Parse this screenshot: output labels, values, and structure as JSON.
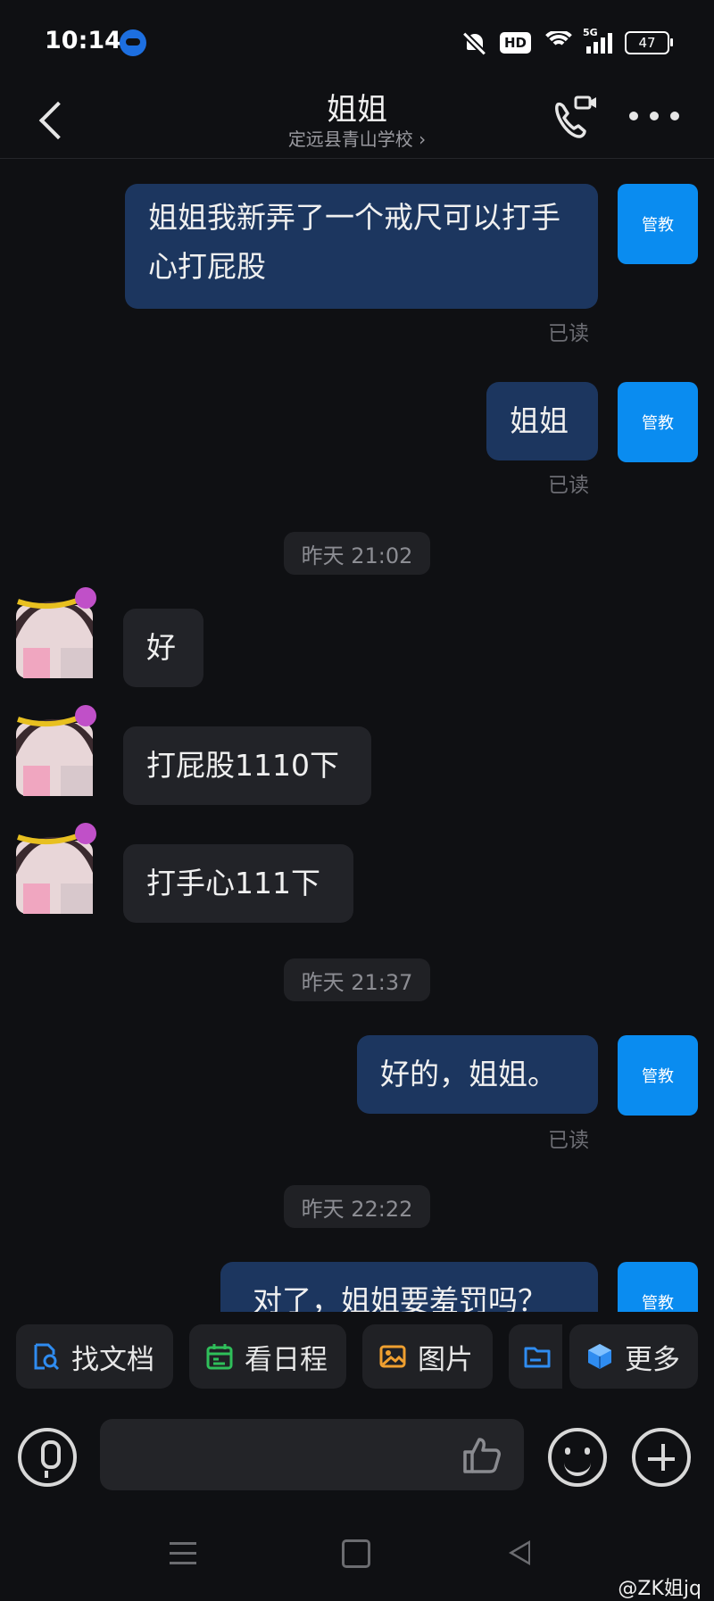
{
  "status_bar": {
    "time": "10:14",
    "hd": "HD",
    "network": "5G",
    "battery": "47"
  },
  "header": {
    "title": "姐姐",
    "subtitle": "定远县青山学校 ›"
  },
  "me": {
    "avatar_text": "管教",
    "accent": "#0a8cf0"
  },
  "messages": [
    {
      "type": "out",
      "text": "姐姐我新弄了一个戒尺可以打手心打屁股",
      "status": "已读"
    },
    {
      "type": "out",
      "text": "姐姐",
      "status": "已读"
    },
    {
      "type": "time",
      "text": "昨天 21:02"
    },
    {
      "type": "in",
      "text": "好"
    },
    {
      "type": "in",
      "text": "打屁股1110下"
    },
    {
      "type": "in",
      "text": "打手心111下"
    },
    {
      "type": "time",
      "text": "昨天 21:37"
    },
    {
      "type": "out",
      "text": "好的，姐姐。",
      "status": "已读"
    },
    {
      "type": "time",
      "text": "昨天 22:22"
    },
    {
      "type": "out",
      "text": "对了，姐姐要羞罚吗？"
    }
  ],
  "quick_actions": [
    {
      "label": "找文档",
      "icon": "doc-search-icon",
      "color": "#2f8cf0"
    },
    {
      "label": "看日程",
      "icon": "calendar-icon",
      "color": "#2fbf5a"
    },
    {
      "label": "图片",
      "icon": "image-icon",
      "color": "#f0a030"
    },
    {
      "label": "",
      "icon": "folder-icon",
      "color": "#2f8cf0"
    },
    {
      "label": "更多",
      "icon": "cube-icon",
      "color": "#2f8cf0"
    }
  ],
  "input": {
    "placeholder": ""
  },
  "watermark": "@ZK姐jq"
}
